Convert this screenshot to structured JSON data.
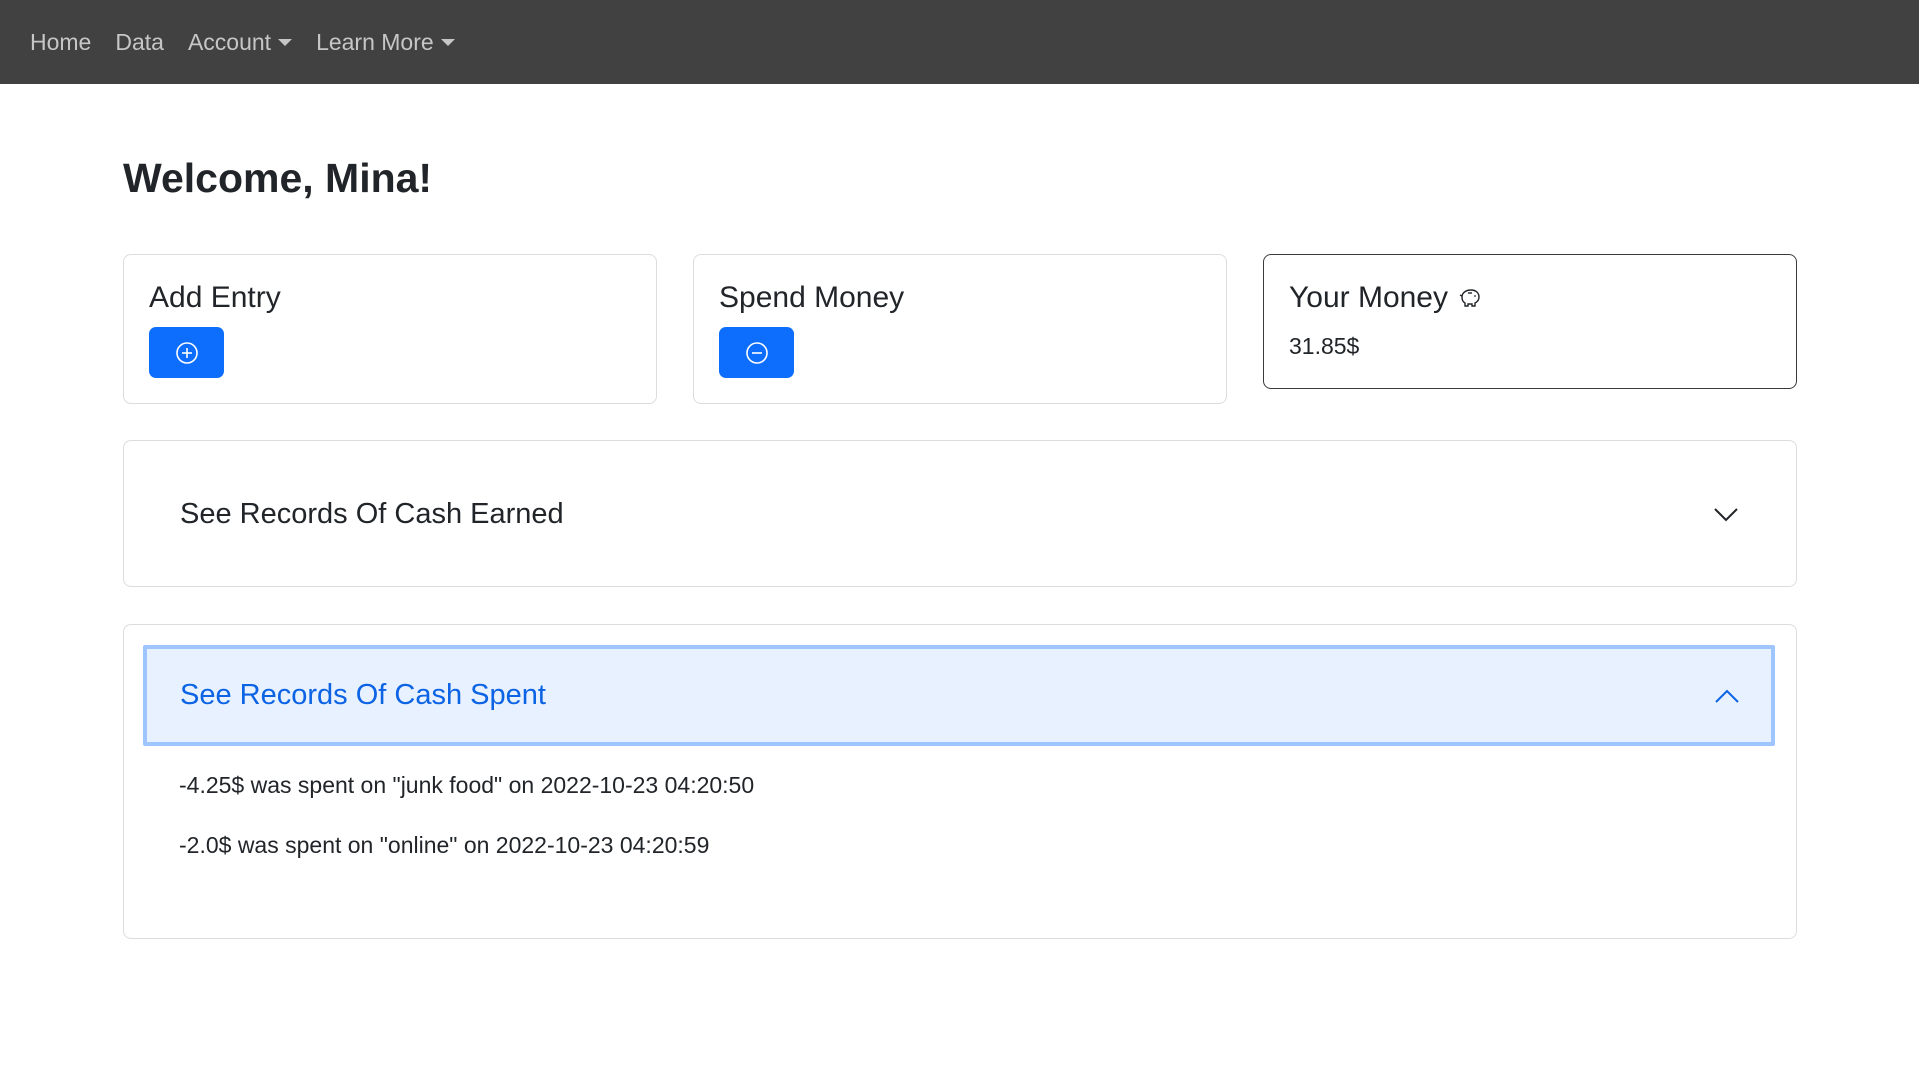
{
  "nav": {
    "items": [
      {
        "label": "Home"
      },
      {
        "label": "Data"
      },
      {
        "label": "Account"
      },
      {
        "label": "Learn More"
      }
    ]
  },
  "welcome": "Welcome, Mina!",
  "cards": {
    "add_entry": {
      "title": "Add Entry",
      "icon": "plus-circle-icon"
    },
    "spend_money": {
      "title": "Spend Money",
      "icon": "dash-circle-icon"
    },
    "your_money": {
      "title": "Your Money",
      "icon": "piggy-bank-icon",
      "value": "31.85$"
    }
  },
  "accordion": {
    "earned": {
      "title": "See Records Of Cash Earned",
      "expanded": false
    },
    "spent": {
      "title": "See Records Of Cash Spent",
      "expanded": true,
      "records": [
        "-4.25$ was spent on \"junk food\" on 2022-10-23 04:20:50",
        "-2.0$ was spent on \"online\" on 2022-10-23 04:20:59"
      ]
    }
  },
  "colors": {
    "navbar": "#414141",
    "primary": "#0d6efd",
    "accordion_active_bg": "#e7f1ff",
    "accordion_active_text": "#0c63e4"
  }
}
